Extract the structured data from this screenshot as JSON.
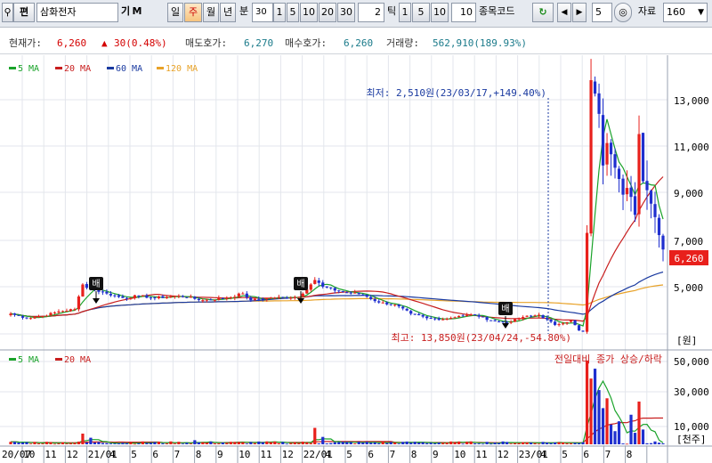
{
  "toolbar": {
    "search_icon": "magnifier-icon",
    "mode_label": "편",
    "stock_name": "삼화전자",
    "btn_gi": "기",
    "btn_m": "M",
    "period_day": "일",
    "period_week": "주",
    "period_month": "월",
    "period_year": "년",
    "period_minute": "분",
    "minute_dropdown": "30",
    "minute_steps": [
      "1",
      "5",
      "10",
      "20",
      "30"
    ],
    "tick_value": "2",
    "tick_label": "틱",
    "tick_steps": [
      "1",
      "5",
      "10"
    ],
    "tick_value2": "10",
    "code_label": "종목코드",
    "refresh_icon": "refresh-icon",
    "prev_icon": "arrow-left-icon",
    "next_icon": "arrow-right-icon",
    "count_value": "5",
    "zoom_icon": "zoom-icon",
    "data_label": "자료",
    "data_count": "160"
  },
  "info_bar": {
    "price_label": "현재가:",
    "price_value": "6,260",
    "change_arrow": "▲",
    "change_value": "30(0.48%)",
    "ask_label": "매도호가:",
    "ask_value": "6,270",
    "bid_label": "매수호가:",
    "bid_value": "6,260",
    "volume_label": "거래량:",
    "volume_value": "562,910(189.93%)"
  },
  "colors": {
    "up": "#e8201c",
    "down": "#1f2fcf",
    "ma5": "#1aa32a",
    "ma20": "#c81e1e",
    "ma60": "#1a3aa0",
    "ma120": "#e8a228",
    "grid": "#e3e6ec",
    "current_price_bg": "#e8201c"
  },
  "chart_data": [
    {
      "type": "candlestick",
      "legend": [
        "5 MA",
        "20 MA",
        "60 MA",
        "120 MA"
      ],
      "ylim": [
        2500,
        14000
      ],
      "y_ticks": [
        "13,000",
        "11,000",
        "9,000",
        "7,000",
        "5,000"
      ],
      "y_unit": "[원]",
      "current_price": "6,260",
      "annotations": {
        "high": "최고: 13,850원(23/04/24,-54.80%)",
        "low": "최저: 2,510원(23/03/17,+149.40%)",
        "markers": [
          "배",
          "배",
          "배"
        ]
      },
      "x_ticks": [
        "20/07",
        "10",
        "11",
        "12",
        "21/01",
        "4",
        "5",
        "6",
        "7",
        "8",
        "9",
        "10",
        "11",
        "12",
        "22/01",
        "4",
        "5",
        "6",
        "7",
        "8",
        "9",
        "10",
        "11",
        "12",
        "23/01",
        "4",
        "5",
        "6",
        "7",
        "8"
      ],
      "anchors": [
        [
          0,
          3400
        ],
        [
          4,
          3200
        ],
        [
          8,
          3300
        ],
        [
          12,
          3500
        ],
        [
          16,
          3600
        ],
        [
          18,
          4700
        ],
        [
          20,
          4500
        ],
        [
          24,
          4300
        ],
        [
          28,
          4100
        ],
        [
          32,
          4200
        ],
        [
          36,
          4100
        ],
        [
          42,
          4200
        ],
        [
          48,
          4000
        ],
        [
          54,
          4100
        ],
        [
          58,
          4300
        ],
        [
          60,
          4000
        ],
        [
          64,
          4100
        ],
        [
          72,
          4150
        ],
        [
          76,
          4900
        ],
        [
          78,
          4600
        ],
        [
          82,
          4400
        ],
        [
          88,
          4250
        ],
        [
          92,
          3900
        ],
        [
          96,
          3800
        ],
        [
          100,
          3400
        ],
        [
          104,
          3200
        ],
        [
          108,
          3150
        ],
        [
          112,
          3300
        ],
        [
          116,
          3350
        ],
        [
          120,
          3100
        ],
        [
          124,
          3000
        ],
        [
          128,
          3250
        ],
        [
          132,
          3350
        ],
        [
          136,
          2900
        ],
        [
          140,
          3100
        ],
        [
          142,
          2650
        ],
        [
          143,
          2600
        ],
        [
          144,
          7000
        ],
        [
          145,
          13800
        ],
        [
          146,
          13200
        ],
        [
          147,
          12300
        ],
        [
          148,
          10000
        ],
        [
          149,
          11000
        ],
        [
          150,
          10500
        ],
        [
          151,
          9900
        ],
        [
          152,
          9400
        ],
        [
          153,
          8700
        ],
        [
          154,
          9000
        ],
        [
          155,
          8600
        ],
        [
          156,
          7800
        ],
        [
          157,
          11400
        ],
        [
          158,
          9300
        ],
        [
          159,
          8900
        ],
        [
          160,
          8300
        ],
        [
          161,
          7700
        ],
        [
          162,
          6900
        ],
        [
          163,
          6260
        ]
      ]
    },
    {
      "type": "bar",
      "legend": [
        "5 MA",
        "20 MA"
      ],
      "ylim": [
        0,
        52000
      ],
      "y_ticks": [
        "50,000",
        "30,000",
        "10,000"
      ],
      "y_unit": "[천주]",
      "title": "전일대비 종가 상승/하락",
      "spikes": [
        [
          18,
          6500
        ],
        [
          20,
          4000
        ],
        [
          46,
          2500
        ],
        [
          76,
          10000
        ],
        [
          78,
          4500
        ],
        [
          144,
          51000
        ],
        [
          145,
          40000
        ],
        [
          146,
          46000
        ],
        [
          147,
          33000
        ],
        [
          148,
          22000
        ],
        [
          149,
          28000
        ],
        [
          150,
          12000
        ],
        [
          151,
          8000
        ],
        [
          152,
          14000
        ],
        [
          155,
          18000
        ],
        [
          156,
          7000
        ],
        [
          157,
          26000
        ],
        [
          158,
          9000
        ]
      ]
    }
  ]
}
